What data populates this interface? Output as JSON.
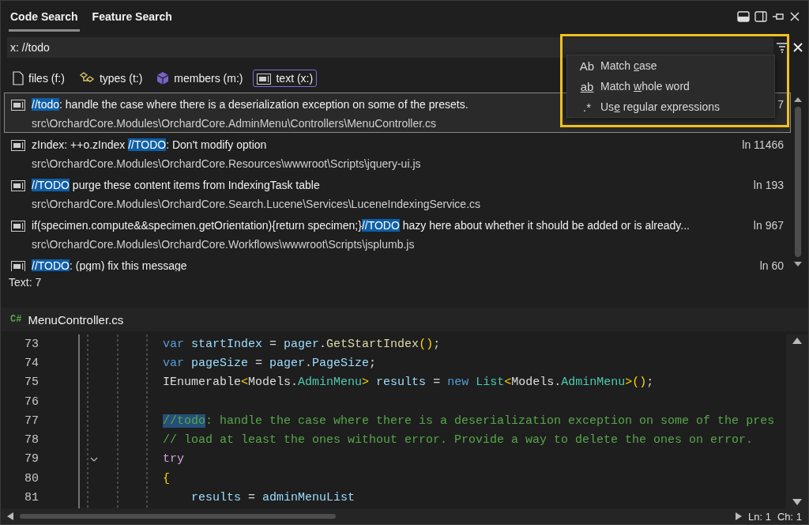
{
  "tabs": [
    {
      "label": "Code Search",
      "selected": true
    },
    {
      "label": "Feature Search",
      "selected": false
    }
  ],
  "search": {
    "value": "x: //todo"
  },
  "filters": [
    {
      "label": "files (f:)",
      "kind": "file",
      "selected": false
    },
    {
      "label": "types (t:)",
      "kind": "type",
      "selected": false
    },
    {
      "label": "members (m:)",
      "kind": "member",
      "selected": false
    },
    {
      "label": "text (x:)",
      "kind": "text",
      "selected": true
    }
  ],
  "options_menu": {
    "items": [
      {
        "icon": "Ab",
        "before": "Match ",
        "key": "c",
        "after": "ase"
      },
      {
        "icon": "ab",
        "before": "Match ",
        "key": "w",
        "after": "hole word"
      },
      {
        "icon": ".*",
        "before": "Us",
        "key": "e",
        "after": " regular expressions"
      }
    ]
  },
  "results": [
    {
      "selected": true,
      "match": "//todo",
      "suffix": ": handle the case where there is a deserialization exception on some of the presets.",
      "path": "src\\OrchardCore.Modules\\OrchardCore.AdminMenu\\Controllers\\MenuController.cs",
      "location": "7"
    },
    {
      "selected": false,
      "prefix": "zIndex: ++o.zIndex ",
      "match": "//TODO",
      "suffix": ": Don't modify option",
      "path": "src\\OrchardCore.Modules\\OrchardCore.Resources\\wwwroot\\Scripts\\jquery-ui.js",
      "location": "ln 11466"
    },
    {
      "selected": false,
      "match": "//TODO",
      "suffix": " purge these content items from IndexingTask table",
      "path": "src\\OrchardCore.Modules\\OrchardCore.Search.Lucene\\Services\\LuceneIndexingService.cs",
      "location": "ln 193"
    },
    {
      "selected": false,
      "prefix": "if(specimen.compute&&specimen.getOrientation){return specimen;}",
      "match": "//TODO",
      "suffix": " hazy here about whether it should be added or is already...",
      "path": "src\\OrchardCore.Modules\\OrchardCore.Workflows\\wwwroot\\Scripts\\jsplumb.js",
      "location": "ln 967"
    },
    {
      "selected": false,
      "match": "//TODO",
      "suffix": ": (pgm) fix this message",
      "location": "ln 60"
    }
  ],
  "result_count": "Text: 7",
  "editor": {
    "language": "C#",
    "file": "MenuController.cs",
    "lines": [
      {
        "number": "73",
        "tokens": [
          {
            "text": "var",
            "kind": "keyword"
          },
          {
            "text": " startIndex",
            "kind": "ident"
          },
          {
            "text": " = ",
            "kind": "punct"
          },
          {
            "text": "pager",
            "kind": "ident"
          },
          {
            "text": ".",
            "kind": "punct"
          },
          {
            "text": "GetStartIndex",
            "kind": "method"
          },
          {
            "text": "()",
            "kind": "brace"
          },
          {
            "text": ";",
            "kind": "punct"
          }
        ]
      },
      {
        "number": "74",
        "tokens": [
          {
            "text": "var",
            "kind": "keyword"
          },
          {
            "text": " pageSize",
            "kind": "ident"
          },
          {
            "text": " = ",
            "kind": "punct"
          },
          {
            "text": "pager",
            "kind": "ident"
          },
          {
            "text": ".",
            "kind": "punct"
          },
          {
            "text": "PageSize",
            "kind": "ident"
          },
          {
            "text": ";",
            "kind": "punct"
          }
        ]
      },
      {
        "number": "75",
        "tokens": [
          {
            "text": "IEnumerable",
            "kind": "plain"
          },
          {
            "text": "<",
            "kind": "brace"
          },
          {
            "text": "Models",
            "kind": "plain"
          },
          {
            "text": ".",
            "kind": "punct"
          },
          {
            "text": "AdminMenu",
            "kind": "type"
          },
          {
            "text": ">",
            "kind": "brace"
          },
          {
            "text": " results",
            "kind": "ident"
          },
          {
            "text": " = ",
            "kind": "punct"
          },
          {
            "text": "new",
            "kind": "keyword"
          },
          {
            "text": " List",
            "kind": "type"
          },
          {
            "text": "<",
            "kind": "brace"
          },
          {
            "text": "Models",
            "kind": "plain"
          },
          {
            "text": ".",
            "kind": "punct"
          },
          {
            "text": "AdminMenu",
            "kind": "type"
          },
          {
            "text": ">",
            "kind": "brace"
          },
          {
            "text": "()",
            "kind": "brace"
          },
          {
            "text": ";",
            "kind": "punct"
          }
        ]
      },
      {
        "number": "76"
      },
      {
        "number": "77",
        "tokens": [
          {
            "text": "//todo",
            "kind": "highlight"
          },
          {
            "text": ": handle the case where there is a deserialization exception on some of the pres",
            "kind": "comment"
          }
        ]
      },
      {
        "number": "78",
        "tokens": [
          {
            "text": "// load at least the ones without error. Provide a way to delete the ones on error.",
            "kind": "comment"
          }
        ]
      },
      {
        "number": "79",
        "collapsible": true,
        "tokens": [
          {
            "text": "try",
            "kind": "control"
          }
        ]
      },
      {
        "number": "80",
        "tokens": [
          {
            "text": "{",
            "kind": "brace"
          }
        ]
      },
      {
        "number": "81",
        "tokens": [
          {
            "text": "    results",
            "kind": "ident"
          },
          {
            "text": " = ",
            "kind": "punct"
          },
          {
            "text": "adminMenuList",
            "kind": "ident"
          }
        ]
      }
    ]
  },
  "status": {
    "line": "Ln: 1",
    "column": "Ch: 1"
  }
}
